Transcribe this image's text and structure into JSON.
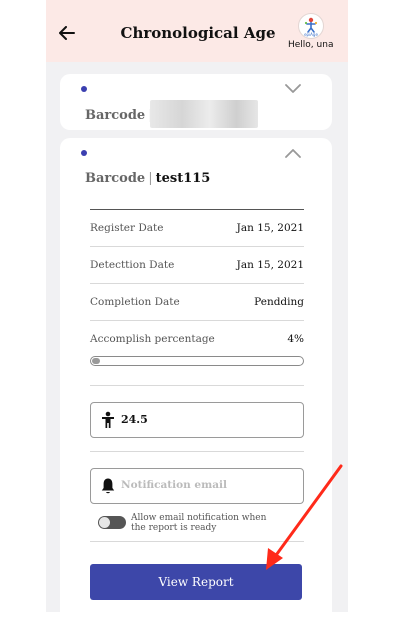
{
  "header": {
    "title": "Chronological Age",
    "greeting": "Hello, una",
    "logo_text": "epiAge"
  },
  "cards": [
    {
      "barcode_label": "Barcode",
      "separator": "|",
      "barcode_value": ""
    },
    {
      "barcode_label": "Barcode",
      "separator": "|",
      "barcode_value": "test115"
    }
  ],
  "details": {
    "register_label": "Register Date",
    "register_value": "Jan 15, 2021",
    "detection_label": "Detecttion Date",
    "detection_value": "Jan 15, 2021",
    "completion_label": "Completion Date",
    "completion_value": "Pendding",
    "percent_label": "Accomplish percentage",
    "percent_value": "4%",
    "progress_fraction": 0.04
  },
  "age_field": {
    "value": "24.5"
  },
  "email_field": {
    "placeholder": "Notification email"
  },
  "toggle": {
    "label": "Allow email notification when the report is ready",
    "on": false
  },
  "action": {
    "view_report": "View Report"
  },
  "colors": {
    "accent": "#3d47a9",
    "header_bg": "#fce9e6",
    "annotation": "#ff2a1a"
  }
}
